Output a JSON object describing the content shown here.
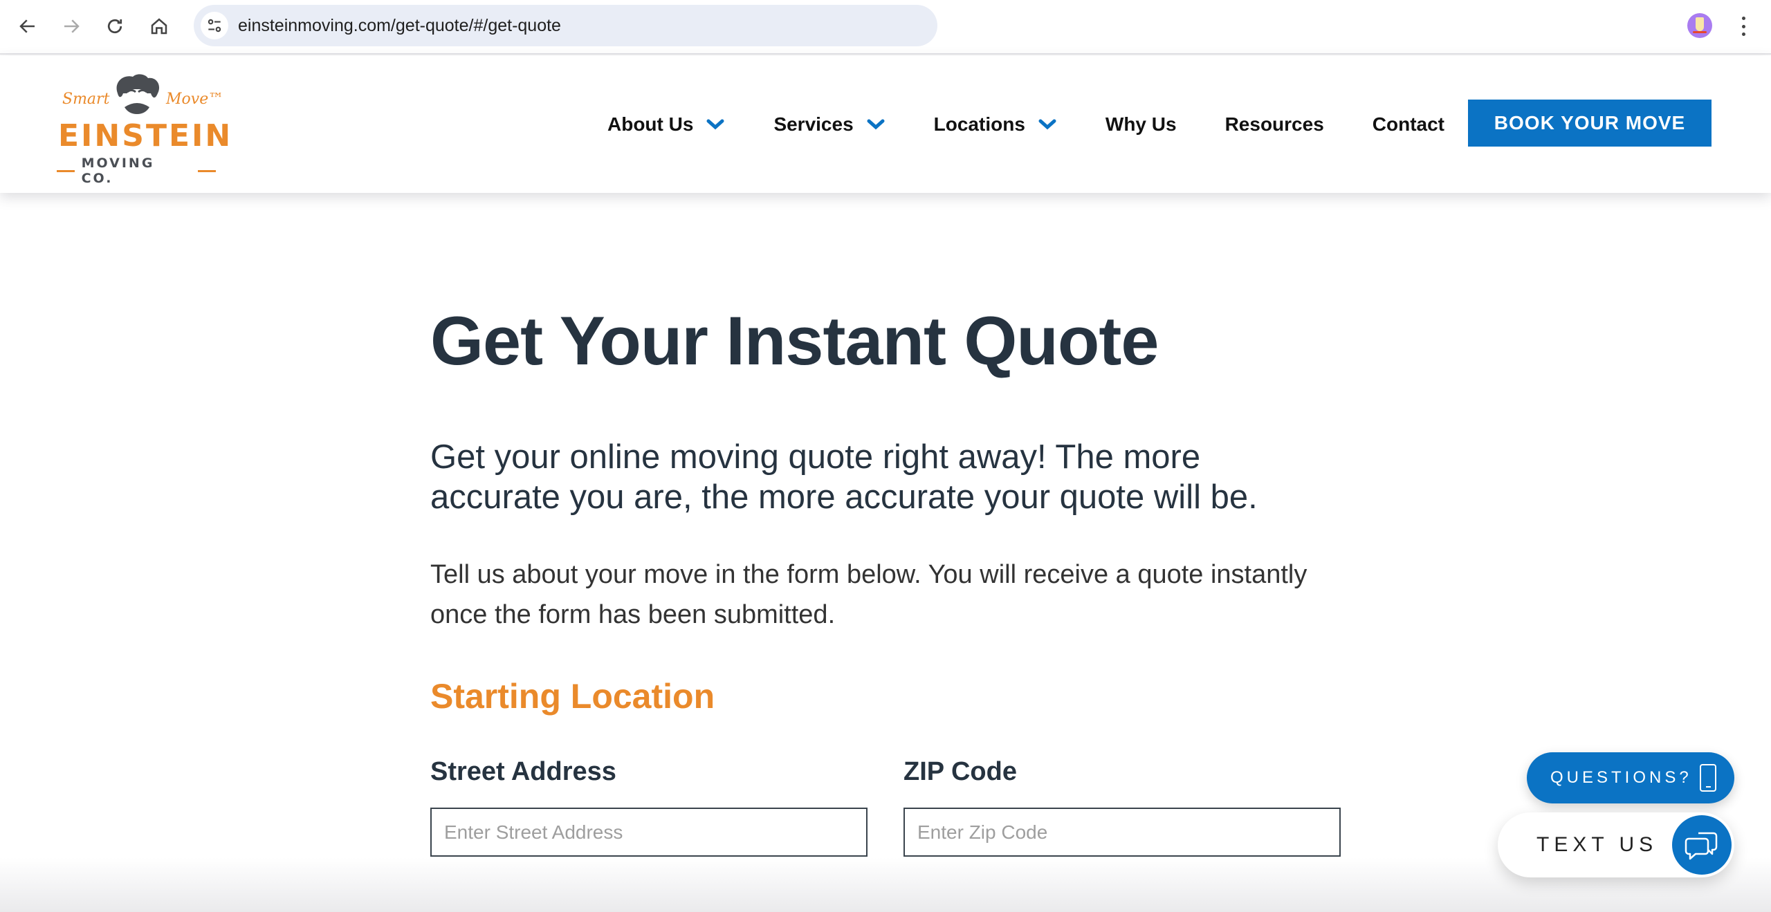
{
  "browser": {
    "url": "einsteinmoving.com/get-quote/#/get-quote",
    "icons": {
      "back": "arrow-left-icon",
      "forward": "arrow-right-icon",
      "reload": "reload-icon",
      "home": "home-icon",
      "site_info": "tune-icon",
      "profile": "profile-avatar",
      "menu": "kebab-menu-icon"
    }
  },
  "header": {
    "logo": {
      "tag_left": "Smart",
      "tag_right": "Move™",
      "brand": "EINSTEIN",
      "sub": "MOVING CO."
    },
    "nav": [
      {
        "label": "About Us",
        "has_dropdown": true
      },
      {
        "label": "Services",
        "has_dropdown": true
      },
      {
        "label": "Locations",
        "has_dropdown": true
      },
      {
        "label": "Why Us",
        "has_dropdown": false
      },
      {
        "label": "Resources",
        "has_dropdown": false
      },
      {
        "label": "Contact",
        "has_dropdown": false
      }
    ],
    "cta_label": "BOOK YOUR MOVE"
  },
  "main": {
    "title": "Get Your Instant Quote",
    "lead": "Get your online moving quote right away! The more accurate you are, the more accurate your quote will be.",
    "body": "Tell us about your move in the form below. You will receive a quote instantly once the form has been submitted.",
    "section_title": "Starting Location",
    "fields": [
      {
        "label": "Street Address",
        "placeholder": "Enter Street Address",
        "value": ""
      },
      {
        "label": "ZIP Code",
        "placeholder": "Enter Zip Code",
        "value": ""
      }
    ]
  },
  "widgets": {
    "questions_label": "QUESTIONS?",
    "text_us_label": "TEXT US"
  },
  "colors": {
    "brand_orange": "#ea8a2b",
    "brand_blue": "#0b73c4",
    "heading_dark": "#263340"
  }
}
